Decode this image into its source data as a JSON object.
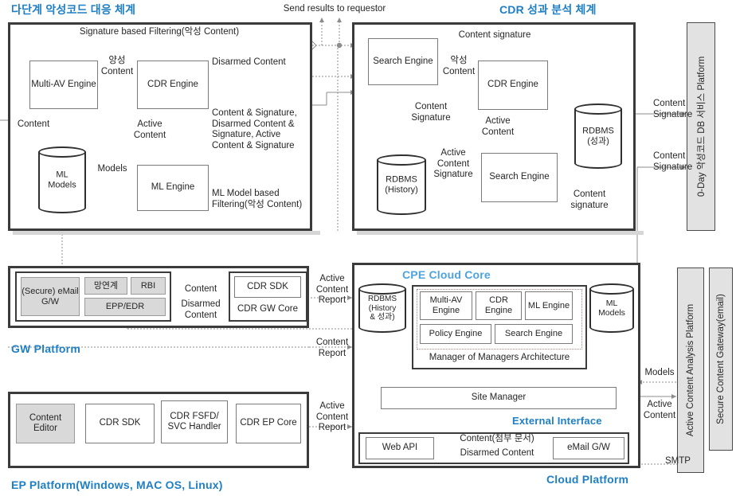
{
  "titles": {
    "multi_stage": "다단계 악성코드 대응 체계",
    "cdr_analysis": "CDR 성과 분석 체계",
    "cpe_cloud_core": "CPE Cloud Core",
    "gw_platform": "GW Platform",
    "ep_platform": "EP Platform(Windows, MAC OS, Linux)",
    "external_interface": "External Interface",
    "cloud_platform": "Cloud Platform"
  },
  "top": {
    "send_results": "Send results to requestor"
  },
  "malware_panel": {
    "signature_filtering": "Signature based Filtering(악성 Content)",
    "multi_av_engine": "Multi-AV\nEngine",
    "cdr_engine": "CDR\nEngine",
    "ml_engine": "ML\nEngine",
    "ml_models_db": "ML\nModels",
    "benign_content": "양성\nContent",
    "disarmed_content": "Disarmed Content",
    "content_signature_block": "Content & Signature,\nDisarmed Content &\nSignature, Active\nContent & Signature",
    "content": "Content",
    "active_content": "Active\nContent",
    "models": "Models",
    "ml_filtering": "ML Model based\nFiltering(악성 Content)"
  },
  "cdr_panel": {
    "search_engine_top": "Search\nEngine",
    "search_engine_bottom": "Search\nEngine",
    "cdr_engine": "CDR\nEngine",
    "rdbms_history": "RDBMS\n(History)",
    "rdbms_result": "RDBMS\n(성과)",
    "content_signature_top": "Content signature",
    "malicious_content": "악성\nContent",
    "content_signature_left": "Content\nSignature",
    "active_content": "Active\nContent",
    "active_content_signature": "Active\nContent\nSignature",
    "content_signature_bottom": "Content\nsignature"
  },
  "right_bars": {
    "zeroday_db": "0-Day 악성코드 DB 서비스 Platform",
    "active_content_analysis": "Active Content Analysis Platform",
    "secure_content_gateway": "Secure Content Gateway(email)"
  },
  "right_labels": {
    "content_signature_upper": "Content\nSignature",
    "content_signature_lower": "Content\nSignature",
    "models": "Models",
    "active_content": "Active\nContent",
    "smtp": "SMTP"
  },
  "gw_platform": {
    "secure_email_gw": "(Secure)\neMail G/W",
    "network_link": "망연계",
    "rbi": "RBI",
    "epp_edr": "EPP/EDR",
    "cdr_sdk": "CDR SDK",
    "cdr_gw_core": "CDR GW Core",
    "content": "Content",
    "disarmed_content": "Disarmed\nContent",
    "active_content_report": "Active\nContent\nReport",
    "content_report": "Content\nReport"
  },
  "ep_platform": {
    "content_editor": "Content\nEditor",
    "cdr_sdk": "CDR SDK",
    "cdr_fsfd": "CDR FSFD/\nSVC\nHandler",
    "cdr_ep_core": "CDR\nEP Core",
    "active_content_report": "Active\nContent\nReport"
  },
  "cloud": {
    "rdbms": "RDBMS\n(History\n& 성과)",
    "multi_av_engine": "Multi-AV\nEngine",
    "cdr_engine": "CDR\nEngine",
    "ml_engine": "ML\nEngine",
    "policy_engine": "Policy Engine",
    "search_engine": "Search Engine",
    "mom_architecture": "Manager of Managers Architecture",
    "ml_models": "ML\nModels",
    "site_manager": "Site Manager",
    "web_api": "Web API",
    "email_gw": "eMail G/W",
    "content_attachment": "Content(첨부 문서)",
    "disarmed_content": "Disarmed Content"
  },
  "colors": {
    "accent": "#1f7fc4",
    "accent_light": "#4da3dd",
    "box_border": "#7b7b7b",
    "panel_border": "#3b3b3b",
    "gray_fill": "#d9d9d9",
    "line": "#8c8c8c"
  }
}
